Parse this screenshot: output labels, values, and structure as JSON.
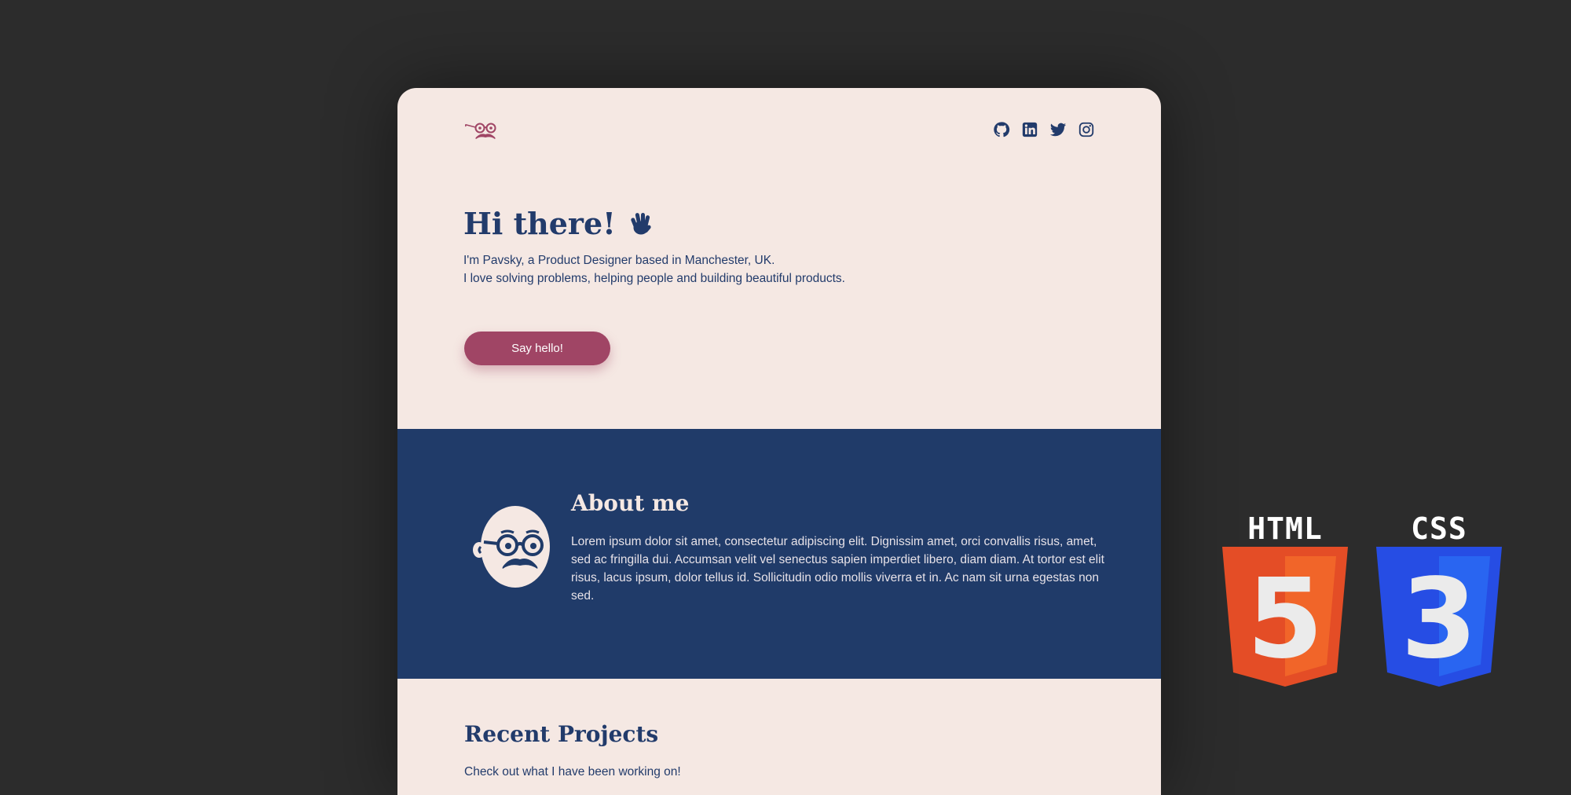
{
  "header": {
    "logo_icon": "glasses-mustache-logo-icon",
    "social": [
      {
        "name": "github",
        "icon": "github-icon"
      },
      {
        "name": "linkedin",
        "icon": "linkedin-icon"
      },
      {
        "name": "twitter",
        "icon": "twitter-icon"
      },
      {
        "name": "instagram",
        "icon": "instagram-icon"
      }
    ]
  },
  "hero": {
    "title": "Hi there!",
    "wave_icon": "waving-hand-icon",
    "line1": "I'm Pavsky, a Product Designer based in Manchester, UK.",
    "line2": "I love solving problems, helping people and building beautiful products.",
    "cta_label": "Say hello!"
  },
  "about": {
    "title": "About me",
    "avatar_icon": "avatar-face-icon",
    "text": "Lorem ipsum dolor sit amet, consectetur adipiscing elit. Dignissim amet, orci convallis risus, amet, sed ac fringilla dui. Accumsan velit vel senectus sapien imperdiet libero, diam diam. At tortor est elit risus, lacus ipsum, dolor tellus id. Sollicitudin odio mollis viverra et in. Ac nam sit urna egestas non sed."
  },
  "projects": {
    "title": "Recent Projects",
    "subtitle": "Check out what I have been working on!"
  },
  "badges": {
    "html_label": "HTML",
    "html_digit": "5",
    "css_label": "CSS",
    "css_digit": "3"
  },
  "colors": {
    "background": "#2c2c2c",
    "cream": "#f5e8e3",
    "navy": "#223b6b",
    "accent": "#a04565",
    "html_orange": "#e44d26",
    "css_blue": "#264de4"
  }
}
